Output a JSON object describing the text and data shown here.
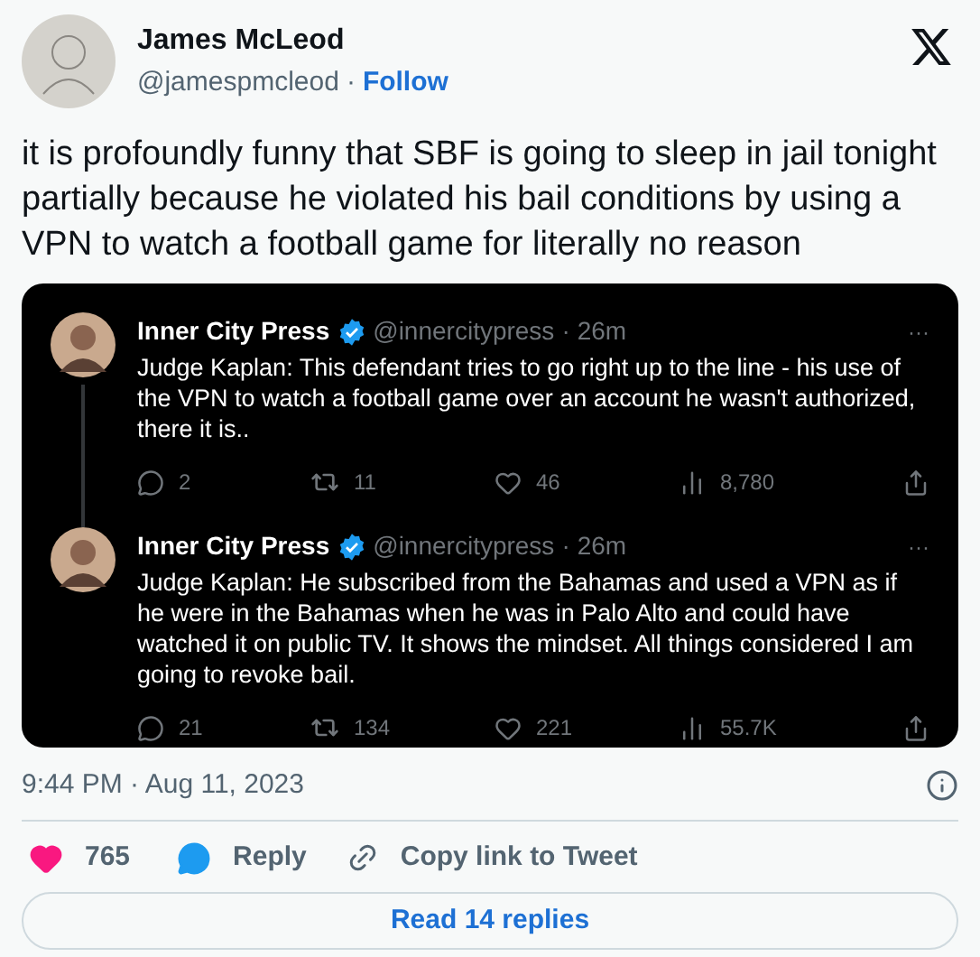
{
  "author": {
    "name": "James McLeod",
    "handle": "@jamespmcleod",
    "separator": "·",
    "follow": "Follow"
  },
  "text": "it is profoundly funny that SBF is going to sleep in jail tonight partially because he violated his bail conditions by using a VPN to watch a football game for literally no reason",
  "quoted_tweets": [
    {
      "name": "Inner City Press",
      "verified": true,
      "handle": "@innercitypress",
      "separator": "·",
      "time": "26m",
      "text": "Judge Kaplan: This defendant tries to go right up to the line - his use of the VPN to watch a football game over an account he wasn't authorized, there it is..",
      "more": "···",
      "stats": {
        "replies": "2",
        "retweets": "11",
        "likes": "46",
        "views": "8,780"
      }
    },
    {
      "name": "Inner City Press",
      "verified": true,
      "handle": "@innercitypress",
      "separator": "·",
      "time": "26m",
      "text": "Judge Kaplan: He subscribed from the Bahamas and used a VPN as if he were in the Bahamas when he was in Palo Alto and could have watched it on public TV. It shows the mindset. All things considered I am going to revoke bail.",
      "more": "···",
      "stats": {
        "replies": "21",
        "retweets": "134",
        "likes": "221",
        "views": "55.7K"
      }
    }
  ],
  "timestamp": "9:44 PM · Aug 11, 2023",
  "actions": {
    "likes": "765",
    "reply": "Reply",
    "copy_link": "Copy link to Tweet"
  },
  "read_replies": "Read 14 replies"
}
